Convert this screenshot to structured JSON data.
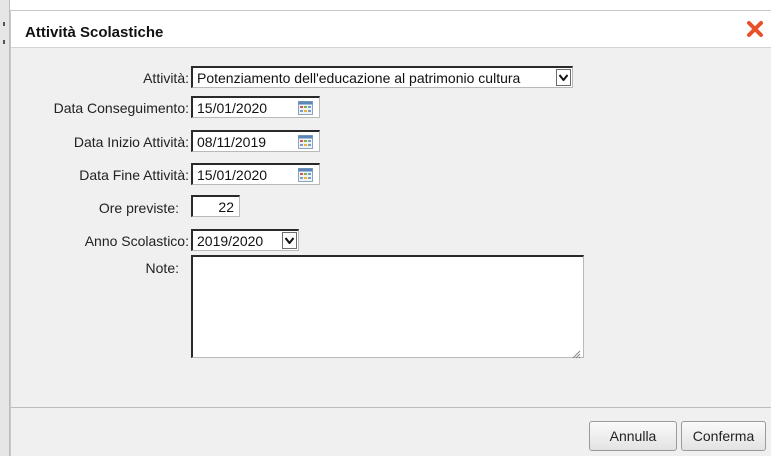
{
  "dialog": {
    "title": "Attività Scolastiche",
    "close_icon": "close-x-icon",
    "close_color": "#e8502a"
  },
  "form": {
    "attivita": {
      "label": "Attività:",
      "value": "Potenziamento dell'educazione al patrimonio cultura"
    },
    "data_conseguimento": {
      "label": "Data Conseguimento:",
      "value": "15/01/2020"
    },
    "data_inizio": {
      "label": "Data Inizio Attività:",
      "value": "08/11/2019"
    },
    "data_fine": {
      "label": "Data Fine Attività:",
      "value": "15/01/2020"
    },
    "ore_previste": {
      "label": "Ore previste:",
      "value": "22"
    },
    "anno_scolastico": {
      "label": "Anno Scolastico:",
      "value": "2019/2020"
    },
    "note": {
      "label": "Note:",
      "value": ""
    }
  },
  "footer": {
    "cancel_label": "Annulla",
    "confirm_label": "Conferma"
  },
  "icons": {
    "calendar": "calendar-icon",
    "dropdown": "chevron-down-icon"
  }
}
